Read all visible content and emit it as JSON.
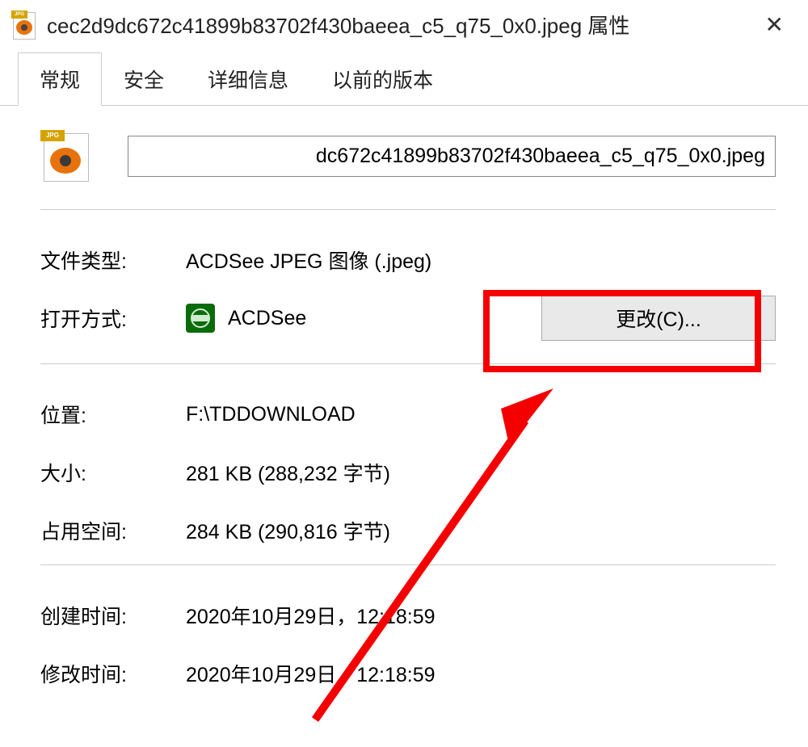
{
  "titlebar": {
    "filename": "cec2d9dc672c41899b83702f430baeea_c5_q75_0x0.jpeg 属性",
    "icon_label": "JPG"
  },
  "tabs": {
    "general": "常规",
    "security": "安全",
    "details": "详细信息",
    "previous": "以前的版本"
  },
  "general": {
    "icon_label": "JPG",
    "filename_display": "dc672c41899b83702f430baeea_c5_q75_0x0.jpeg",
    "file_type_label": "文件类型:",
    "file_type_value": "ACDSee JPEG 图像 (.jpeg)",
    "open_with_label": "打开方式:",
    "open_with_value": "ACDSee",
    "change_button": "更改(C)...",
    "location_label": "位置:",
    "location_value": "F:\\TDDOWNLOAD",
    "size_label": "大小:",
    "size_value": "281 KB (288,232 字节)",
    "size_on_disk_label": "占用空间:",
    "size_on_disk_value": "284 KB (290,816 字节)",
    "created_label": "创建时间:",
    "created_value": "2020年10月29日，12:18:59",
    "modified_label": "修改时间:",
    "modified_value": "2020年10月29日，12:18:59"
  }
}
